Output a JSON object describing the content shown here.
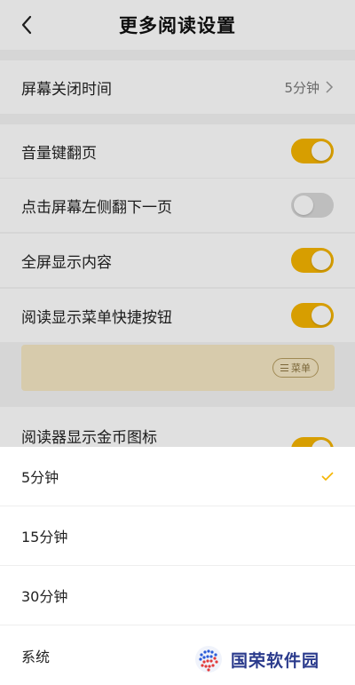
{
  "header": {
    "title": "更多阅读设置",
    "back_icon": "chevron-left-icon"
  },
  "screen_off": {
    "label": "屏幕关闭时间",
    "value": "5分钟"
  },
  "settings": [
    {
      "label": "音量键翻页",
      "enabled": true
    },
    {
      "label": "点击屏幕左侧翻下一页",
      "enabled": false
    },
    {
      "label": "全屏显示内容",
      "enabled": true
    },
    {
      "label": "阅读显示菜单快捷按钮",
      "enabled": true
    },
    {
      "label": "阅读器显示金币图标",
      "enabled": true
    }
  ],
  "preview": {
    "menu_label": "菜单"
  },
  "picker": {
    "options": [
      {
        "label": "5分钟",
        "selected": true
      },
      {
        "label": "15分钟",
        "selected": false
      },
      {
        "label": "30分钟",
        "selected": false
      },
      {
        "label": "系统",
        "selected": false
      }
    ]
  },
  "watermark": {
    "text": "国荣软件园"
  },
  "colors": {
    "accent": "#f5b400",
    "toggle_off": "#d9d9d9",
    "preview_bg": "#f5e8c4"
  }
}
